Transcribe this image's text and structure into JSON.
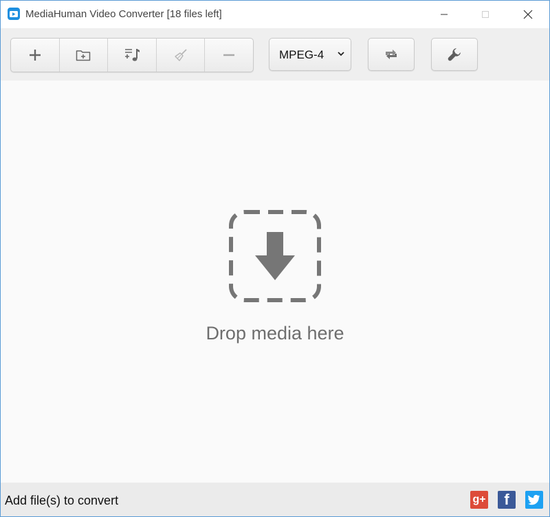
{
  "window": {
    "title": "MediaHuman Video Converter [18 files left]"
  },
  "toolbar": {
    "buttons": [
      {
        "icon": "plus-icon"
      },
      {
        "icon": "add-folder-icon"
      },
      {
        "icon": "add-playlist-icon"
      },
      {
        "icon": "broom-icon"
      },
      {
        "icon": "minus-icon"
      }
    ],
    "format": {
      "selected": "MPEG-4"
    },
    "convert_icon": "convert-arrows-icon",
    "settings_icon": "wrench-icon"
  },
  "main": {
    "drop_text": "Drop media here",
    "drop_icon": "drop-arrow-icon"
  },
  "statusbar": {
    "text": "Add file(s) to convert",
    "social": {
      "gplus": "g+",
      "facebook": "f"
    }
  },
  "colors": {
    "accent": "#1d8fe0",
    "icon_gray": "#707070",
    "gplus": "#dd4b39",
    "facebook": "#3b5998",
    "twitter": "#1da1f2"
  }
}
